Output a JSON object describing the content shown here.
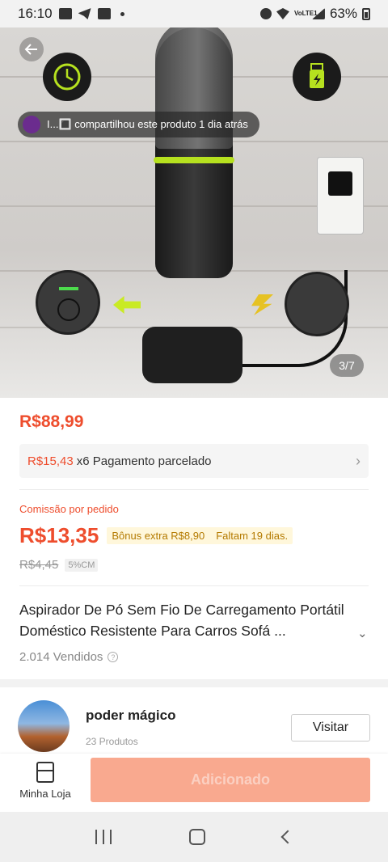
{
  "status_bar": {
    "time": "16:10",
    "battery": "63%",
    "network": "VoLTE1"
  },
  "product_image": {
    "image_counter": "3/7",
    "share_text": "I...🔳 compartilhou este produto 1 dia atrás"
  },
  "price": {
    "main": "R$88,99",
    "installment_price": "R$15,43",
    "installment_text": "x6 Pagamento parcelado"
  },
  "commission": {
    "label": "Comissão por pedido",
    "value": "R$13,35",
    "bonus": "Bônus extra R$8,90",
    "remaining": "Faltam 19 dias.",
    "old_value": "R$4,45",
    "rate": "5%CM"
  },
  "product": {
    "title": "Aspirador De Pó Sem Fio De Carregamento Portátil Doméstico Resistente Para Carros Sofá ...",
    "sold": "2.014 Vendidos"
  },
  "shop": {
    "name": "poder mágico",
    "products_count": "23 Produtos",
    "visit_label": "Visitar"
  },
  "action_bar": {
    "my_store_label": "Minha Loja",
    "add_label": "Adicionado"
  },
  "colors": {
    "accent": "#ee4d2d",
    "add_button": "#f9a98f",
    "vacuum_ring": "#b6e11f"
  }
}
